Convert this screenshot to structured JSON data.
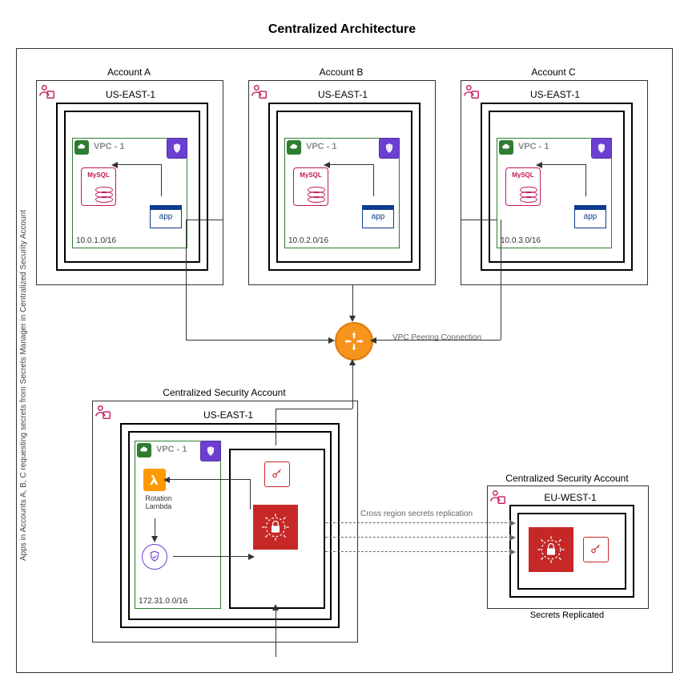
{
  "title": "Centralized Architecture",
  "side_note": "Apps in Accounts A, B, C requesting secrets from Secrets Manager in Centralized Security Account",
  "labels": {
    "vpc_peering": "VPC Peering Connection",
    "cross_region_repl": "Cross region secrets replication",
    "secrets_replicated": "Secrets Replicated"
  },
  "peer_hub": {
    "name": "transit-gateway-icon"
  },
  "accounts": [
    {
      "id": "a",
      "title": "Account A",
      "region_title": "US-EAST-1",
      "vpc_label": "VPC - 1",
      "cidr": "10.0.1.0/16",
      "mysql": "MySQL",
      "app": "app"
    },
    {
      "id": "b",
      "title": "Account B",
      "region_title": "US-EAST-1",
      "vpc_label": "VPC - 1",
      "cidr": "10.0.2.0/16",
      "mysql": "MySQL",
      "app": "app"
    },
    {
      "id": "c",
      "title": "Account C",
      "region_title": "US-EAST-1",
      "vpc_label": "VPC - 1",
      "cidr": "10.0.3.0/16",
      "mysql": "MySQL",
      "app": "app"
    }
  ],
  "security_account": {
    "title": "Centralized Security Account",
    "region_title": "US-EAST-1",
    "vpc_label": "VPC - 1",
    "cidr": "172.31.0.0/16",
    "rotation_lambda_line1": "Rotation",
    "rotation_lambda_line2": "Lambda"
  },
  "replica_account": {
    "title": "Centralized Security Account",
    "region_title": "EU-WEST-1"
  }
}
